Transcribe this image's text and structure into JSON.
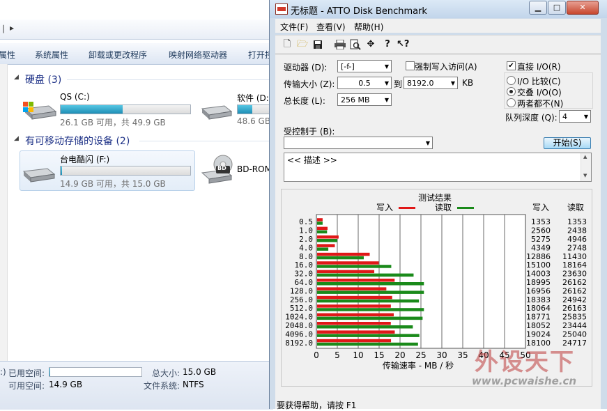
{
  "explorer": {
    "nav_arrow": "▸",
    "commands": [
      "属性",
      "系统属性",
      "卸载或更改程序",
      "映射网络驱动器",
      "打开控"
    ],
    "hard_disks": {
      "title": "硬盘 (3)",
      "drives": [
        {
          "name": "QS (C:)",
          "free": "26.1 GB 可用，共 49.9 GB",
          "used_fraction": 0.477
        },
        {
          "name": "软件 (D:",
          "free": "48.6 GB",
          "used_fraction": 0.4
        }
      ]
    },
    "removable": {
      "title": "有可移动存储的设备 (2)",
      "drives": [
        {
          "name": "台电酷闪 (F:)",
          "free": "14.9 GB 可用，共 15.0 GB",
          "used_fraction": 0.007
        },
        {
          "name": "BD-ROM",
          "badge": "BD"
        }
      ]
    },
    "details": {
      "used_label": "已用空间:",
      "free_label": "可用空间:",
      "free_value": "14.9 GB",
      "total_label": "总大小:",
      "total_value": "15.0 GB",
      "fs_label": "文件系统:",
      "fs_value": "NTFS",
      "used_fraction": 0.007
    }
  },
  "atto": {
    "title": "无标题 - ATTO Disk Benchmark",
    "window_buttons": {
      "minimize": "▁",
      "maximize": "□",
      "close": "✕"
    },
    "menu": [
      "文件(F)",
      "查看(V)",
      "帮助(H)"
    ],
    "toolbar_icons": [
      "new-icon",
      "open-icon",
      "save-icon",
      "print-icon",
      "print-preview-icon",
      "move-icon",
      "help-icon",
      "context-help-icon"
    ],
    "drive_label": "驱动器 (D):",
    "drive_value": "[-f-]",
    "force_write_label": "强制写入访问(A)",
    "force_write_checked": false,
    "transfer_label": "传输大小 (Z):",
    "transfer_from": "0.5",
    "to_label": "到",
    "transfer_to": "8192.0",
    "kb_label": "KB",
    "length_label": "总长度 (L):",
    "length_value": "256 MB",
    "direct_io_label": "直接 I/O(R)",
    "direct_io_checked": true,
    "io_compare_label": "I/O 比较(C)",
    "overlapped_label": "交叠 I/O(O)",
    "neither_label": "两者都不(N)",
    "selected_io": "overlapped",
    "queue_label": "队列深度 (Q):",
    "queue_value": "4",
    "controlled_by_label": "受控制于 (B):",
    "controlled_by_value": "",
    "start_label": "开始(S)",
    "description": "<< 描述 >>",
    "status": "要获得帮助，请按 F1"
  },
  "chart_data": {
    "type": "bar",
    "title": "测试结果",
    "xlabel": "传输速率 - MB / 秒",
    "xlim": [
      0,
      50
    ],
    "xticks": [
      0,
      5,
      10,
      15,
      20,
      25,
      30,
      35,
      40,
      45,
      50
    ],
    "categories": [
      "0.5",
      "1.0",
      "2.0",
      "4.0",
      "8.0",
      "16.0",
      "32.0",
      "64.0",
      "128.0",
      "256.0",
      "512.0",
      "1024.0",
      "2048.0",
      "4096.0",
      "8192.0"
    ],
    "series": [
      {
        "name": "写入",
        "color": "#e01818",
        "values": [
          1353,
          2560,
          5275,
          4349,
          12886,
          15100,
          14003,
          18995,
          16956,
          18383,
          18064,
          18771,
          18052,
          19024,
          18100
        ]
      },
      {
        "name": "读取",
        "color": "#1a8a1a",
        "values": [
          1353,
          2438,
          4946,
          2748,
          11430,
          18164,
          23630,
          26162,
          26162,
          24942,
          26163,
          25835,
          23444,
          25040,
          24717
        ]
      }
    ],
    "value_units": "KB/s",
    "table_headers": [
      "写入",
      "读取"
    ],
    "grid": true,
    "legend": "top"
  },
  "watermark": {
    "main": "外设天下",
    "url": "www.pcwaishe.cn"
  }
}
